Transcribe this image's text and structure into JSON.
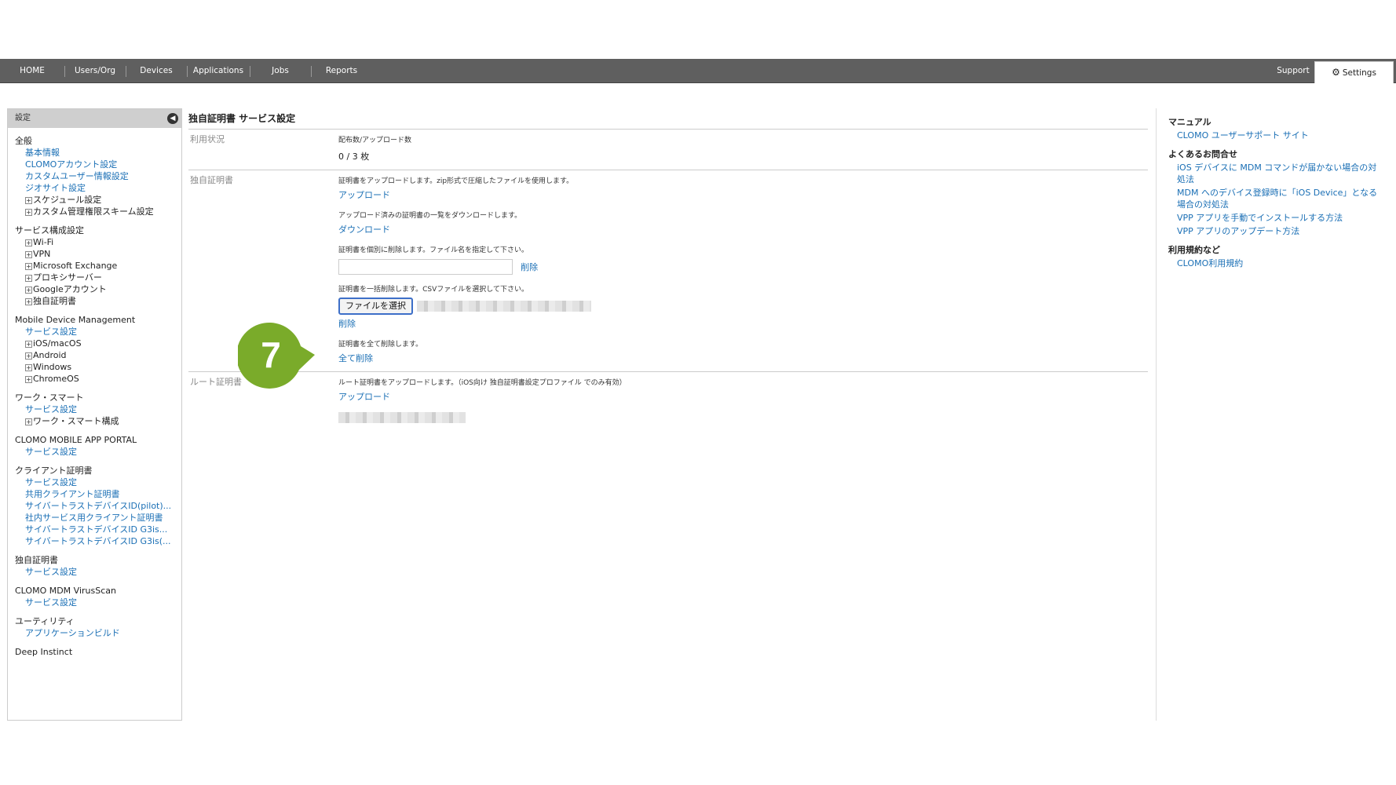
{
  "nav": {
    "items": [
      "HOME",
      "Users/Org",
      "Devices",
      "Applications",
      "Jobs",
      "Reports"
    ],
    "support": "Support",
    "settings": "Settings"
  },
  "sidebar": {
    "header": "設定",
    "sections": [
      {
        "title": "全般",
        "items": [
          {
            "type": "link",
            "label": "基本情報"
          },
          {
            "type": "link",
            "label": "CLOMOアカウント設定"
          },
          {
            "type": "link",
            "label": "カスタムユーザー情報設定"
          },
          {
            "type": "link",
            "label": "ジオサイト設定"
          },
          {
            "type": "expand",
            "label": "スケジュール設定"
          },
          {
            "type": "expand",
            "label": "カスタム管理権限スキーム設定"
          }
        ]
      },
      {
        "title": "サービス構成設定",
        "items": [
          {
            "type": "expand",
            "label": "Wi-Fi"
          },
          {
            "type": "expand",
            "label": "VPN"
          },
          {
            "type": "expand",
            "label": "Microsoft Exchange"
          },
          {
            "type": "expand",
            "label": "プロキシサーバー"
          },
          {
            "type": "expand",
            "label": "Googleアカウント"
          },
          {
            "type": "expand",
            "label": "独自証明書"
          }
        ]
      },
      {
        "title": "Mobile Device Management",
        "items": [
          {
            "type": "link",
            "label": "サービス設定"
          },
          {
            "type": "expand",
            "label": "iOS/macOS"
          },
          {
            "type": "expand",
            "label": "Android"
          },
          {
            "type": "expand",
            "label": "Windows"
          },
          {
            "type": "expand",
            "label": "ChromeOS"
          }
        ]
      },
      {
        "title": "ワーク・スマート",
        "items": [
          {
            "type": "link",
            "label": "サービス設定"
          },
          {
            "type": "expand",
            "label": "ワーク・スマート構成"
          }
        ]
      },
      {
        "title": "CLOMO MOBILE APP PORTAL",
        "items": [
          {
            "type": "link",
            "label": "サービス設定"
          }
        ]
      },
      {
        "title": "クライアント証明書",
        "items": [
          {
            "type": "link",
            "label": "サービス設定"
          },
          {
            "type": "link",
            "label": "共用クライアント証明書"
          },
          {
            "type": "link",
            "label": "サイバートラストデバイスID(pilot)..."
          },
          {
            "type": "link",
            "label": "社内サービス用クライアント証明書"
          },
          {
            "type": "link",
            "label": "サイバートラストデバイスID G3is..."
          },
          {
            "type": "link",
            "label": "サイバートラストデバイスID G3is(..."
          }
        ]
      },
      {
        "title": "独自証明書",
        "items": [
          {
            "type": "link",
            "label": "サービス設定"
          }
        ]
      },
      {
        "title": "CLOMO MDM VirusScan",
        "items": [
          {
            "type": "link",
            "label": "サービス設定"
          }
        ]
      },
      {
        "title": "ユーティリティ",
        "items": [
          {
            "type": "link",
            "label": "アプリケーションビルド"
          }
        ]
      },
      {
        "title": "Deep Instinct",
        "items": []
      }
    ]
  },
  "main": {
    "title": "独自証明書 サービス設定",
    "usage": {
      "label": "利用状況",
      "desc": "配布数/アップロード数",
      "count": "0 / 3 枚"
    },
    "cert": {
      "label": "独自証明書",
      "upload_desc": "証明書をアップロードします。zip形式で圧縮したファイルを使用します。",
      "upload_link": "アップロード",
      "download_desc": "アップロード済みの証明書の一覧をダウンロードします。",
      "download_link": "ダウンロード",
      "delete_single_desc": "証明書を個別に削除します。ファイル名を指定して下さい。",
      "delete_single_link": "削除",
      "delete_bulk_desc": "証明書を一括削除します。CSVファイルを選択して下さい。",
      "choose_file": "ファイルを選択",
      "delete_bulk_link": "削除",
      "delete_all_desc": "証明書を全て削除します。",
      "delete_all_link": "全て削除"
    },
    "root": {
      "label": "ルート証明書",
      "desc": "ルート証明書をアップロードします。（iOS向け 独自証明書設定プロファイル でのみ有効）",
      "upload_link": "アップロード"
    }
  },
  "step_marker": "7",
  "right_panel": {
    "sections": [
      {
        "title": "マニュアル",
        "links": [
          "CLOMO ユーザーサポート サイト"
        ]
      },
      {
        "title": "よくあるお問合せ",
        "links": [
          "iOS デバイスに MDM コマンドが届かない場合の対処法",
          "MDM へのデバイス登録時に「iOS Device」となる場合の対処法",
          "VPP アプリを手動でインストールする方法",
          "VPP アプリのアップデート方法"
        ]
      },
      {
        "title": "利用規約など",
        "links": [
          "CLOMO利用規約"
        ]
      }
    ]
  },
  "colors": {
    "nav_bg": "#5f5f5f",
    "link": "#1a6fb5",
    "marker_green": "#7aab2a"
  }
}
